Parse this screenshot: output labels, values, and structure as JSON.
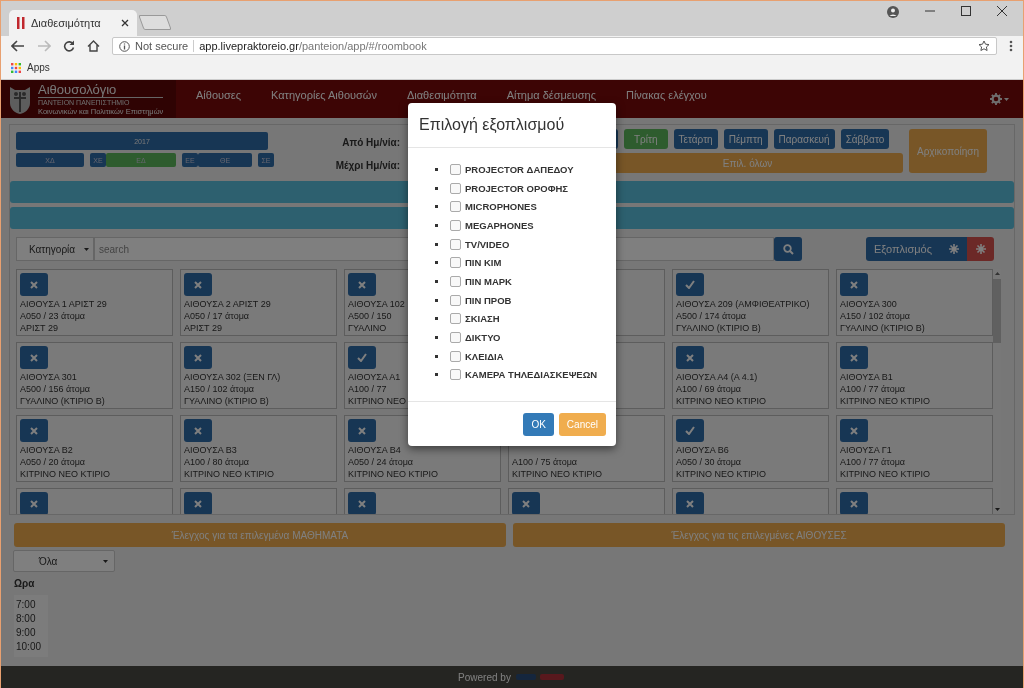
{
  "browser": {
    "tab_title": "Διαθεσιμότητα",
    "security": "Not secure",
    "host": "app.livepraktoreio.gr",
    "path": "/panteion/app/#/roombook",
    "bookmarks": [
      "Apps"
    ]
  },
  "navbar": {
    "title": "Αιθουσολόγιο",
    "subtitle_1": "ΠΑΝΤΕΙΟΝ ΠΑΝΕΠΙΣΤΗΜΙΟ",
    "subtitle_2": "Κοινωνικών και Πολιτικών Επιστημών",
    "links": [
      "Αίθουσες",
      "Κατηγορίες Αιθουσών",
      "Διαθεσιμότητα",
      "Αίτημα δέσμευσης",
      "Πίνακας ελέγχου"
    ]
  },
  "semester": {
    "year": "2017",
    "terms": [
      {
        "label": "ΧΔ",
        "selected": false
      },
      {
        "label": "ΧΕ",
        "selected": false
      },
      {
        "label": "ΕΔ",
        "selected": true
      },
      {
        "label": "ΕΕ",
        "selected": false
      },
      {
        "label": "ΘΕ",
        "selected": false
      },
      {
        "label": "ΣΕ",
        "selected": false
      }
    ]
  },
  "date_labels": [
    "Από Ημ/νία:",
    "Μέχρι Ημ/νία:"
  ],
  "days": [
    {
      "selected": false
    },
    {
      "label": "Τρίτη",
      "selected": true
    },
    {
      "label": "Τετάρτη",
      "selected": false
    },
    {
      "label": "Πέμπτη",
      "selected": false
    },
    {
      "label": "Παρασκευή",
      "selected": false
    },
    {
      "label": "Σάββατο",
      "selected": false
    }
  ],
  "select_all": "Επιλ. όλων",
  "reset": "Αρχικοποίηση",
  "filter": {
    "category": "Κατηγορία",
    "search_placeholder": "search",
    "equipment": "Εξοπλισμός"
  },
  "rooms": [
    {
      "kind": "room",
      "available": false,
      "name": "ΑΙΘΟΥΣΑ 1 ΑΡΙΣΤ 29",
      "size": "Α050 / 23 άτομα",
      "building": "ΑΡΙΣΤ 29"
    },
    {
      "kind": "room",
      "available": false,
      "name": "ΑΙΘΟΥΣΑ 2 ΑΡΙΣΤ 29",
      "size": "Α050 / 17 άτομα",
      "building": "ΑΡΙΣΤ 29"
    },
    {
      "kind": "room",
      "available": false,
      "name": "ΑΙΘΟΥΣΑ 102",
      "size": "Α500 / 150",
      "building": "ΓΥΑΛΙΝΟ"
    },
    {
      "kind": "covered"
    },
    {
      "kind": "room",
      "available": true,
      "name": "ΑΙΘΟΥΣΑ 209 (ΑΜΦΙΘΕΑΤΡΙΚΟ)",
      "size": "Α500 / 174 άτομα",
      "building": "ΓΥΑΛΙΝΟ (ΚΤΙΡΙΟ Β)"
    },
    {
      "kind": "room",
      "available": false,
      "name": "ΑΙΘΟΥΣΑ 300",
      "size": "Α150 / 102 άτομα",
      "building": "ΓΥΑΛΙΝΟ (ΚΤΙΡΙΟ Β)"
    },
    {
      "kind": "room",
      "available": false,
      "name": "ΑΙΘΟΥΣΑ 301",
      "size": "Α500 / 156 άτομα",
      "building": "ΓΥΑΛΙΝΟ (ΚΤΙΡΙΟ Β)"
    },
    {
      "kind": "room",
      "available": false,
      "name": "ΑΙΘΟΥΣΑ 302 (ΞΕΝ ΓΛ)",
      "size": "Α150 / 102 άτομα",
      "building": "ΓΥΑΛΙΝΟ (ΚΤΙΡΙΟ Β)"
    },
    {
      "kind": "room",
      "available": true,
      "name": "ΑΙΘΟΥΣΑ Α1",
      "size": "Α100 / 77",
      "building": "ΚΙΤΡΙΝΟ ΝΕΟ"
    },
    {
      "kind": "covered"
    },
    {
      "kind": "room",
      "available": false,
      "name": "ΑΙΘΟΥΣΑ Α4 (Α 4.1)",
      "size": "Α100 / 69 άτομα",
      "building": "ΚΙΤΡΙΝΟ ΝΕΟ ΚΤΙΡΙΟ"
    },
    {
      "kind": "room",
      "available": false,
      "name": "ΑΙΘΟΥΣΑ Β1",
      "size": "Α100 / 77 άτομα",
      "building": "ΚΙΤΡΙΝΟ ΝΕΟ ΚΤΙΡΙΟ"
    },
    {
      "kind": "room",
      "available": false,
      "name": "ΑΙΘΟΥΣΑ Β2",
      "size": "Α050 / 20 άτομα",
      "building": "ΚΙΤΡΙΝΟ ΝΕΟ ΚΤΙΡΙΟ"
    },
    {
      "kind": "room",
      "available": false,
      "name": "ΑΙΘΟΥΣΑ Β3",
      "size": "Α100 / 80 άτομα",
      "building": "ΚΙΤΡΙΝΟ ΝΕΟ ΚΤΙΡΙΟ"
    },
    {
      "kind": "room",
      "available": false,
      "name": "ΑΙΘΟΥΣΑ Β4",
      "size": "Α050 / 24 άτομα",
      "building": "ΚΙΤΡΙΝΟ ΝΕΟ ΚΤΙΡΙΟ"
    },
    {
      "kind": "room",
      "size": "Α100 / 75 άτομα",
      "building": "ΚΙΤΡΙΝΟ ΝΕΟ ΚΤΙΡΙΟ"
    },
    {
      "kind": "room",
      "available": true,
      "name": "ΑΙΘΟΥΣΑ Β6",
      "size": "Α050 / 30 άτομα",
      "building": "ΚΙΤΡΙΝΟ ΝΕΟ ΚΤΙΡΙΟ"
    },
    {
      "kind": "room",
      "available": false,
      "name": "ΑΙΘΟΥΣΑ Γ1",
      "size": "Α100 / 77 άτομα",
      "building": "ΚΙΤΡΙΝΟ ΝΕΟ ΚΤΙΡΙΟ"
    },
    {
      "kind": "room",
      "available": false
    },
    {
      "kind": "room",
      "available": false
    },
    {
      "kind": "room",
      "available": false
    },
    {
      "kind": "room",
      "available": false
    },
    {
      "kind": "room",
      "available": false
    },
    {
      "kind": "room",
      "available": false
    }
  ],
  "check_buttons": [
    "Έλεγχος για τα επιλεγμένα ΜΑΘΗΜΑΤΑ",
    "Έλεγχος για τις επιλεγμένες ΑΙΘΟΥΣΕΣ"
  ],
  "period_select": "Όλα",
  "schedule": {
    "header": "Ωρα",
    "times": [
      "7:00",
      "8:00",
      "9:00",
      "10:00"
    ]
  },
  "footer": {
    "text": "Powered by"
  },
  "modal": {
    "title": "Επιλογή εξοπλισμού",
    "items": [
      {
        "label": "PROJECTOR ΔΑΠΕΔΟΥ",
        "checked": false
      },
      {
        "label": "PROJECTOR ΟΡΟΦΗΣ",
        "checked": false
      },
      {
        "label": "MICROPHONES",
        "checked": false
      },
      {
        "label": "MEGAPHONES",
        "checked": false
      },
      {
        "label": "TV/VIDEO",
        "checked": false
      },
      {
        "label": "ΠΙΝ ΚΙΜ",
        "checked": false
      },
      {
        "label": "ΠΙΝ ΜΑΡΚ",
        "checked": false
      },
      {
        "label": "ΠΙΝ ΠΡΟΒ",
        "checked": false
      },
      {
        "label": "ΣΚΙΑΣΗ",
        "checked": false
      },
      {
        "label": "ΔΙΚΤΥΟ",
        "checked": false
      },
      {
        "label": "ΚΛΕΙΔΙΑ",
        "checked": false
      },
      {
        "label": "ΚΑΜΕΡΑ ΤΗΛΕΔΙΑΣΚΕΨΕΩΝ",
        "checked": false
      }
    ],
    "buttons": [
      {
        "label": "OK",
        "kind": "primary"
      },
      {
        "label": "Cancel",
        "kind": "warning"
      }
    ]
  }
}
